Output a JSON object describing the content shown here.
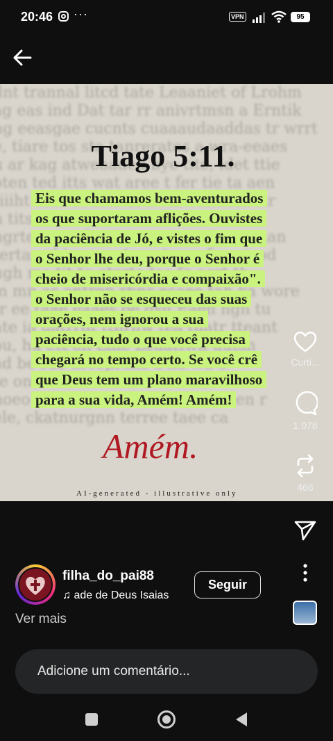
{
  "status_bar": {
    "time": "20:46",
    "vpn_label": "VPN",
    "battery": "95",
    "overflow_icon": "more-dots-icon"
  },
  "header": {
    "back_icon": "arrow-left-icon"
  },
  "post": {
    "title": "Tiago 5:11.",
    "verse_lines": [
      "Eis que chamamos bem-aventurados",
      "os que suportaram aflições. Ouvistes",
      "da paciência de Jó, e vistes o fim que",
      "o Senhor lhe deu, porque o Senhor é",
      "cheio de misericórdia e compaixão\".",
      "o Senhor não se esqueceu das suas",
      "orações, nem ignorou a sua",
      "paciência, tudo o que você precisa",
      "chegará no tempo certo. Se você crê",
      "que Deus tem um plano maravilhoso",
      "para a sua vida, Amém! Amém!"
    ],
    "signature": "Amém.",
    "ai_notice": "AI-generated - illustrative only",
    "highlight_color": "#c9f27e",
    "signature_color": "#b01822"
  },
  "actions": {
    "like_label": "Curti...",
    "comments_count": "1.078",
    "reposts_count": "466"
  },
  "author": {
    "username": "filha_do_pai88",
    "music": "ade de Deus    Isaias",
    "follow_label": "Seguir",
    "see_more": "Ver mais"
  },
  "comment_box": {
    "placeholder": "Adicione um comentário..."
  },
  "accent": "#ffffff"
}
